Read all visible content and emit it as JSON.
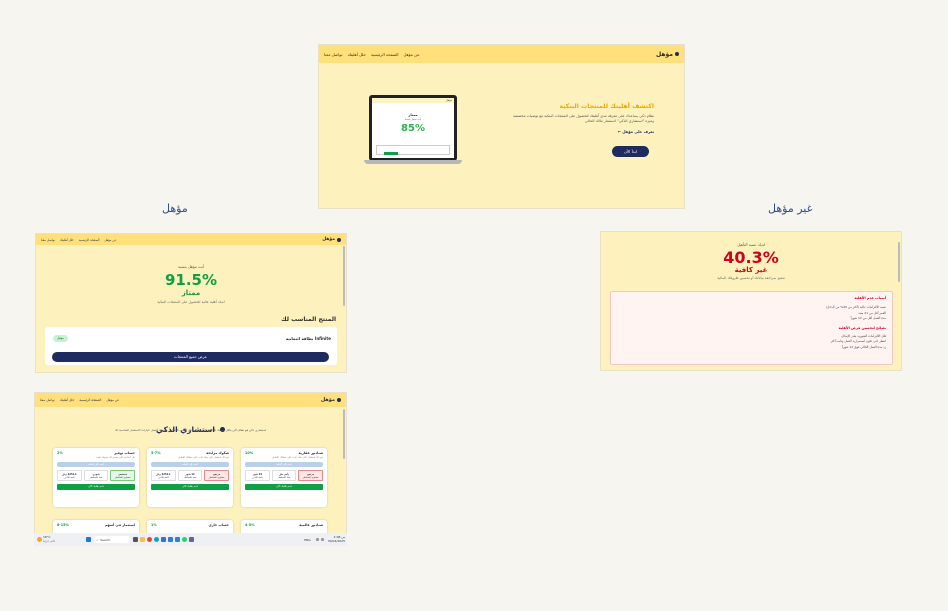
{
  "captions": {
    "eligible": "مؤهل",
    "not_eligible": "غير مؤهل"
  },
  "nav": {
    "logo": "مؤهل",
    "items": [
      "عن مؤهل",
      "الصفحة الرئيسية",
      "حلل أهليتك",
      "تواصل معنا"
    ]
  },
  "hero": {
    "title": "اكتشف أهليتك للمنتجات البنكية",
    "desc": "نظام ذكي يساعدك على معرفة مدى أهليتك للحصول على المنتجات البنكية مع توصيات مخصصة وميزة \"استشاري الذكي\" لاستثمار مالك الحالي",
    "link": "تعرف على مؤهل ←",
    "button": "ابدأ الآن",
    "laptop": {
      "logo": "مؤهل",
      "grade": "ممتاز",
      "sub": "أنت مؤهل بنسبة",
      "percent": "85%"
    }
  },
  "eligible_page": {
    "intro": "أنت مؤهل بنسبة",
    "percent": "91.5%",
    "grade": "ممتاز",
    "desc": "لديك أهلية عالية للحصول على المنتجات البنكية",
    "section_title": "المنتج المناسب لك",
    "product": "بطاقة ائتمانية",
    "product_sub": "Infinite",
    "badge": "مؤهل",
    "button": "عرض جميع المنتجات"
  },
  "not_eligible_page": {
    "intro": "لديك نسبة التأهيل",
    "percent": "40.3%",
    "grade": "غير كافية",
    "desc": "ننصح بمراجعة بياناتك أو تحسين ظروفك المالية",
    "reasons_title": "أسباب عدم الأهلية",
    "reasons": [
      "نسبة الالتزامات عالية (أكثر من 40% من الدخل)",
      "العمر أقل من 21 سنة",
      "مدة العمل أقل من 12 شهراً"
    ],
    "tips_title": "نصائح لتحسين فرص الأهلية",
    "tips": [
      "قلل الالتزامات الشهرية بقدر الإمكان",
      "انتظر حتى تكون استمرارية العمل وثابت أكثر",
      "زد مدة العمل الحالي فوق 12 شهراً"
    ]
  },
  "advisor": {
    "title": "استشاري الذكي",
    "desc": "استشاري ذكي هو نظام ذكي يحلل وضعك المالي بناء على المدخل ونسب المخاطر ويمنحك أفضل خيارات الاستثمار المناسبة لك",
    "cards": [
      {
        "title": "صناديق عقارية",
        "rate": "10%",
        "desc": "يتيح لك استثمار ذكي بعائد ثابت على عملائك السابق",
        "tag": "أضف إلى الملف",
        "boxes": [
          "مرتفع",
          "رأس مال",
          "24 شهر"
        ],
        "boxes_sub": [
          "مستوى المخاطر",
          "مدة الاستثمار",
          "الحد الأدنى"
        ],
        "btn": "قدم طلبك الآن"
      },
      {
        "title": "صكوك مرابحة",
        "rate": "5-7%",
        "desc": "يتيح لك استثمار ذكي بعائد ثابت على عملائك السابق",
        "tag": "أضف إلى الملف",
        "boxes": [
          "مرتفع",
          "12 شهر",
          "$251.1 ريال"
        ],
        "boxes_sub": [
          "مستوى المخاطر",
          "مدة الاستثمار",
          "الحد الأدنى"
        ],
        "btn": "قدم طلبك الآن"
      },
      {
        "title": "حساب توفير",
        "rate": "2%",
        "desc": "حل ادخاري ذكي يضمن لك سيولة دائمة",
        "tag": "أضف إلى الملف",
        "boxes": [
          "منخفض",
          "شهري",
          "$251.1 ريال"
        ],
        "boxes_sub": [
          "مستوى المخاطر",
          "مدة الاستثمار",
          "الحد الأدنى"
        ],
        "btn": "قدم طلبك الآن"
      }
    ],
    "row2": [
      {
        "title": "صناديق عالمية",
        "rate": "4-5%"
      },
      {
        "title": "حساب جاري",
        "rate": "1%"
      },
      {
        "title": "استثمار في أسهم",
        "rate": "8-15%"
      }
    ]
  },
  "taskbar": {
    "weather": "18°C",
    "weather_sub": "غائم جزئيا",
    "search": "Search",
    "time": "2:08 ص",
    "date": "30/04/2025",
    "lang": "ENG"
  },
  "colors": {
    "nav_yellow": "#ffe07a",
    "page_bg": "#fdf2bd",
    "navy": "#1f2a5e",
    "green": "#0ea044",
    "red": "#d0021b",
    "orange": "#f0a500"
  }
}
